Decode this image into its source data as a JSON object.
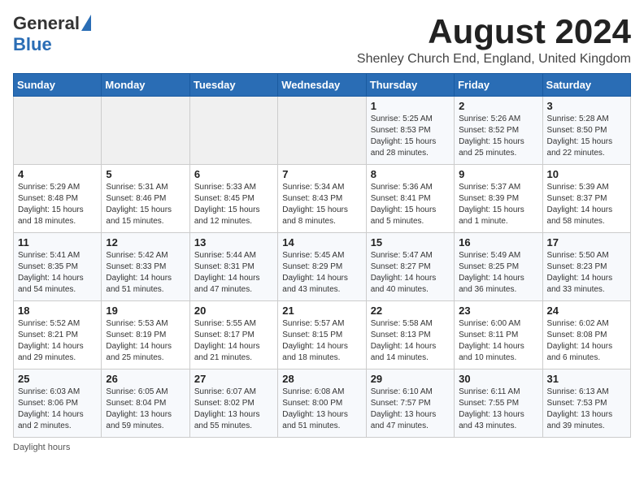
{
  "logo": {
    "general": "General",
    "blue": "Blue"
  },
  "title": "August 2024",
  "subtitle": "Shenley Church End, England, United Kingdom",
  "header_days": [
    "Sunday",
    "Monday",
    "Tuesday",
    "Wednesday",
    "Thursday",
    "Friday",
    "Saturday"
  ],
  "footer": "Daylight hours",
  "weeks": [
    [
      {
        "day": "",
        "info": ""
      },
      {
        "day": "",
        "info": ""
      },
      {
        "day": "",
        "info": ""
      },
      {
        "day": "",
        "info": ""
      },
      {
        "day": "1",
        "info": "Sunrise: 5:25 AM\nSunset: 8:53 PM\nDaylight: 15 hours\nand 28 minutes."
      },
      {
        "day": "2",
        "info": "Sunrise: 5:26 AM\nSunset: 8:52 PM\nDaylight: 15 hours\nand 25 minutes."
      },
      {
        "day": "3",
        "info": "Sunrise: 5:28 AM\nSunset: 8:50 PM\nDaylight: 15 hours\nand 22 minutes."
      }
    ],
    [
      {
        "day": "4",
        "info": "Sunrise: 5:29 AM\nSunset: 8:48 PM\nDaylight: 15 hours\nand 18 minutes."
      },
      {
        "day": "5",
        "info": "Sunrise: 5:31 AM\nSunset: 8:46 PM\nDaylight: 15 hours\nand 15 minutes."
      },
      {
        "day": "6",
        "info": "Sunrise: 5:33 AM\nSunset: 8:45 PM\nDaylight: 15 hours\nand 12 minutes."
      },
      {
        "day": "7",
        "info": "Sunrise: 5:34 AM\nSunset: 8:43 PM\nDaylight: 15 hours\nand 8 minutes."
      },
      {
        "day": "8",
        "info": "Sunrise: 5:36 AM\nSunset: 8:41 PM\nDaylight: 15 hours\nand 5 minutes."
      },
      {
        "day": "9",
        "info": "Sunrise: 5:37 AM\nSunset: 8:39 PM\nDaylight: 15 hours\nand 1 minute."
      },
      {
        "day": "10",
        "info": "Sunrise: 5:39 AM\nSunset: 8:37 PM\nDaylight: 14 hours\nand 58 minutes."
      }
    ],
    [
      {
        "day": "11",
        "info": "Sunrise: 5:41 AM\nSunset: 8:35 PM\nDaylight: 14 hours\nand 54 minutes."
      },
      {
        "day": "12",
        "info": "Sunrise: 5:42 AM\nSunset: 8:33 PM\nDaylight: 14 hours\nand 51 minutes."
      },
      {
        "day": "13",
        "info": "Sunrise: 5:44 AM\nSunset: 8:31 PM\nDaylight: 14 hours\nand 47 minutes."
      },
      {
        "day": "14",
        "info": "Sunrise: 5:45 AM\nSunset: 8:29 PM\nDaylight: 14 hours\nand 43 minutes."
      },
      {
        "day": "15",
        "info": "Sunrise: 5:47 AM\nSunset: 8:27 PM\nDaylight: 14 hours\nand 40 minutes."
      },
      {
        "day": "16",
        "info": "Sunrise: 5:49 AM\nSunset: 8:25 PM\nDaylight: 14 hours\nand 36 minutes."
      },
      {
        "day": "17",
        "info": "Sunrise: 5:50 AM\nSunset: 8:23 PM\nDaylight: 14 hours\nand 33 minutes."
      }
    ],
    [
      {
        "day": "18",
        "info": "Sunrise: 5:52 AM\nSunset: 8:21 PM\nDaylight: 14 hours\nand 29 minutes."
      },
      {
        "day": "19",
        "info": "Sunrise: 5:53 AM\nSunset: 8:19 PM\nDaylight: 14 hours\nand 25 minutes."
      },
      {
        "day": "20",
        "info": "Sunrise: 5:55 AM\nSunset: 8:17 PM\nDaylight: 14 hours\nand 21 minutes."
      },
      {
        "day": "21",
        "info": "Sunrise: 5:57 AM\nSunset: 8:15 PM\nDaylight: 14 hours\nand 18 minutes."
      },
      {
        "day": "22",
        "info": "Sunrise: 5:58 AM\nSunset: 8:13 PM\nDaylight: 14 hours\nand 14 minutes."
      },
      {
        "day": "23",
        "info": "Sunrise: 6:00 AM\nSunset: 8:11 PM\nDaylight: 14 hours\nand 10 minutes."
      },
      {
        "day": "24",
        "info": "Sunrise: 6:02 AM\nSunset: 8:08 PM\nDaylight: 14 hours\nand 6 minutes."
      }
    ],
    [
      {
        "day": "25",
        "info": "Sunrise: 6:03 AM\nSunset: 8:06 PM\nDaylight: 14 hours\nand 2 minutes."
      },
      {
        "day": "26",
        "info": "Sunrise: 6:05 AM\nSunset: 8:04 PM\nDaylight: 13 hours\nand 59 minutes."
      },
      {
        "day": "27",
        "info": "Sunrise: 6:07 AM\nSunset: 8:02 PM\nDaylight: 13 hours\nand 55 minutes."
      },
      {
        "day": "28",
        "info": "Sunrise: 6:08 AM\nSunset: 8:00 PM\nDaylight: 13 hours\nand 51 minutes."
      },
      {
        "day": "29",
        "info": "Sunrise: 6:10 AM\nSunset: 7:57 PM\nDaylight: 13 hours\nand 47 minutes."
      },
      {
        "day": "30",
        "info": "Sunrise: 6:11 AM\nSunset: 7:55 PM\nDaylight: 13 hours\nand 43 minutes."
      },
      {
        "day": "31",
        "info": "Sunrise: 6:13 AM\nSunset: 7:53 PM\nDaylight: 13 hours\nand 39 minutes."
      }
    ]
  ]
}
